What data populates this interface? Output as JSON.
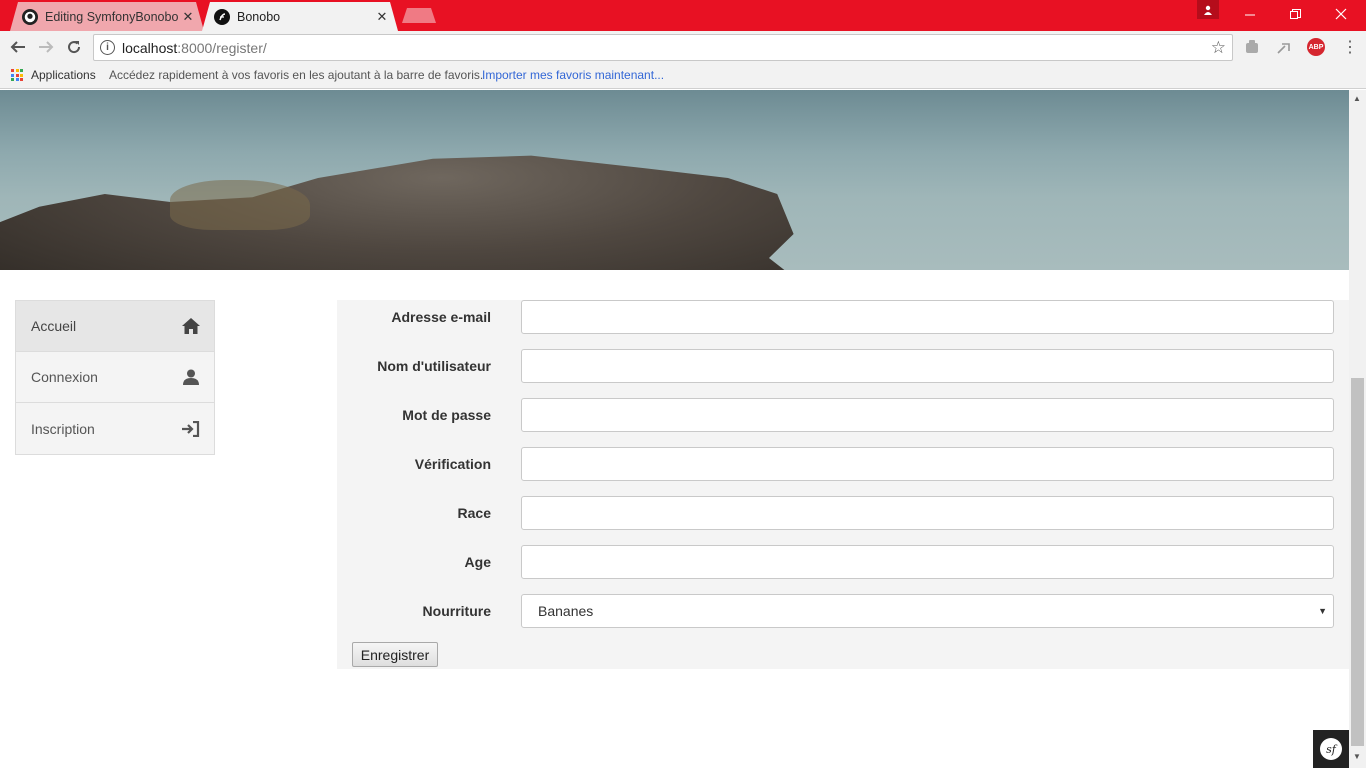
{
  "browser": {
    "tabs": [
      {
        "title": "Editing SymfonyBonobo/",
        "icon": "github-icon",
        "active": false
      },
      {
        "title": "Bonobo",
        "icon": "symfony-icon",
        "active": true
      }
    ],
    "tab_close_glyph": "✕",
    "url_host": "localhost",
    "url_rest": ":8000/register/",
    "bookmarks": {
      "apps_label": "Applications",
      "hint": "Accédez rapidement à vos favoris en les ajoutant à la barre de favoris.",
      "import_link": "Importer mes favoris maintenant..."
    },
    "accent_color": "#e81123"
  },
  "sidebar": {
    "items": [
      {
        "label": "Accueil",
        "icon": "home-icon",
        "active": true
      },
      {
        "label": "Connexion",
        "icon": "user-icon",
        "active": false
      },
      {
        "label": "Inscription",
        "icon": "login-icon",
        "active": false
      }
    ]
  },
  "form": {
    "fields": [
      {
        "label": "Adresse e-mail",
        "value": ""
      },
      {
        "label": "Nom d'utilisateur",
        "value": ""
      },
      {
        "label": "Mot de passe",
        "value": ""
      },
      {
        "label": "Vérification",
        "value": ""
      },
      {
        "label": "Race",
        "value": ""
      },
      {
        "label": "Age",
        "value": ""
      },
      {
        "label": "Nourriture",
        "value": "Bananes"
      }
    ],
    "submit_label": "Enregistrer"
  },
  "debug_toolbar": {
    "logo_text": "sf"
  }
}
